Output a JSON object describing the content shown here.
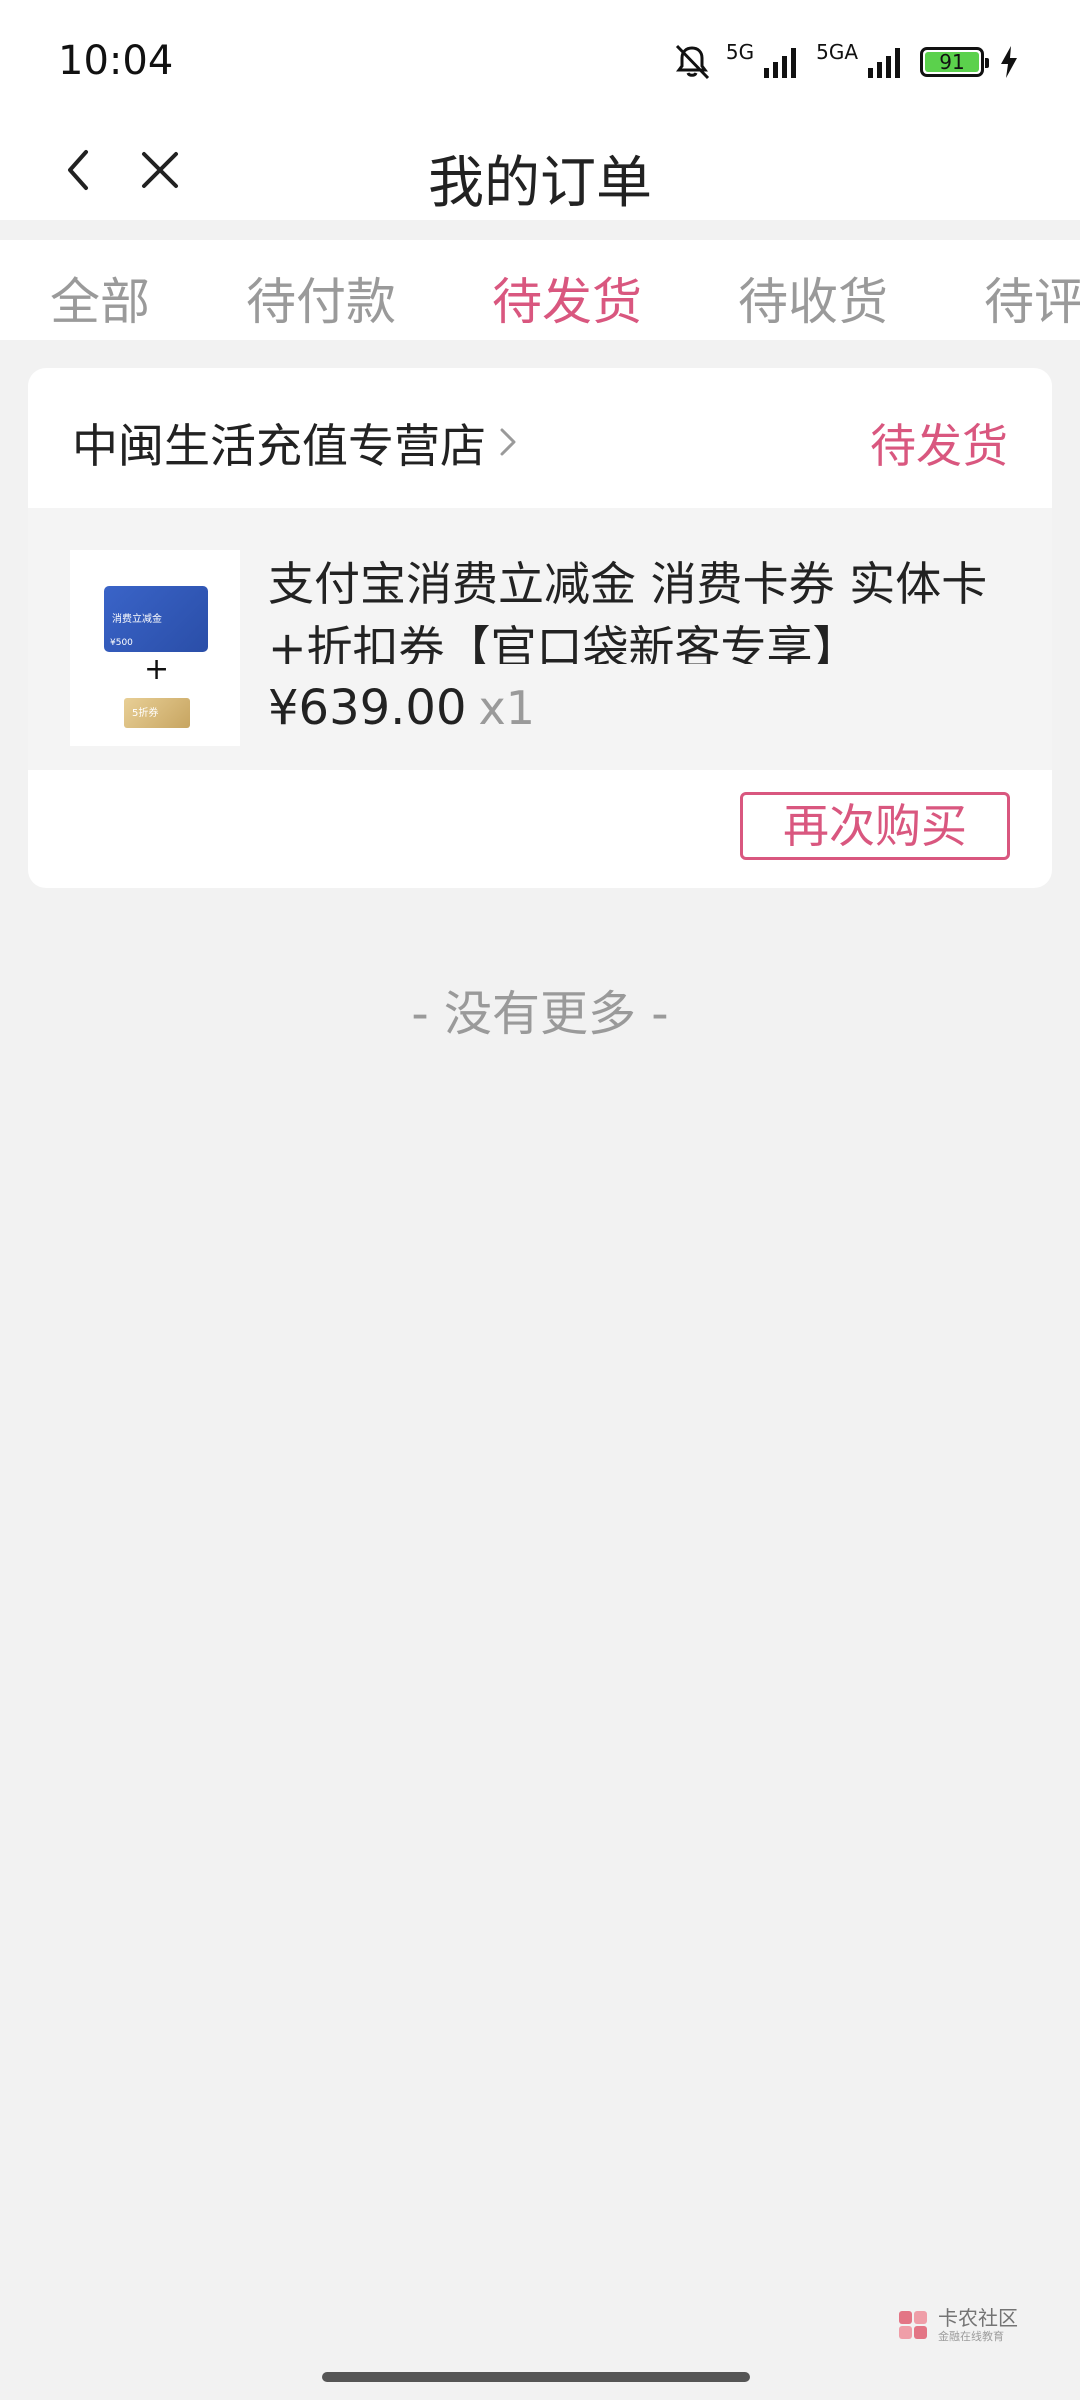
{
  "status_bar": {
    "time": "10:04",
    "network_1": "5G",
    "network_2": "5GA",
    "battery": "91",
    "icons": [
      "mute-bell-icon",
      "signal-icon",
      "signal-icon",
      "battery-icon",
      "charging-icon"
    ]
  },
  "header": {
    "title": "我的订单",
    "icons": [
      "back-icon",
      "close-icon"
    ]
  },
  "tabs": [
    {
      "label": "全部",
      "active": false
    },
    {
      "label": "待付款",
      "active": false
    },
    {
      "label": "待发货",
      "active": true
    },
    {
      "label": "待收货",
      "active": false
    },
    {
      "label": "待评",
      "active": false
    }
  ],
  "order": {
    "shop_name": "中闽生活充值专营店",
    "status": "待发货",
    "product": {
      "title": "支付宝消费立减金 消费卡券 实体卡+折扣券【官口袋新客专享】",
      "thumb_card_text": "消费立减金",
      "thumb_card_amount": "¥500",
      "thumb_plus": "+",
      "thumb_coupon_text": "5折券",
      "price": "¥639.00",
      "quantity": "x1"
    },
    "rebuy_button": "再次购买"
  },
  "footer_text": "- 没有更多 -",
  "watermark": {
    "title": "卡农社区",
    "subtitle": "金融在线教育"
  },
  "colors": {
    "accent": "#d9577f",
    "background": "#f2f2f2",
    "muted_text": "#9a9a9a"
  }
}
